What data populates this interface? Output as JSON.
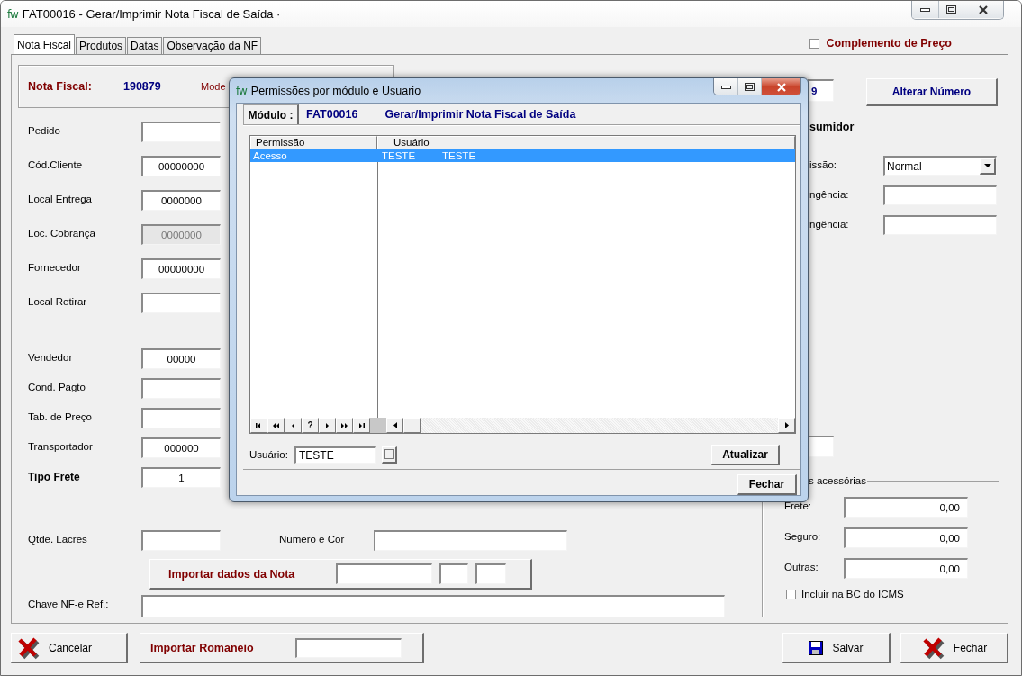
{
  "window": {
    "logo": "fw",
    "title": "FAT00016 - Gerar/Imprimir Nota Fiscal de Saída ·"
  },
  "tabs": [
    {
      "label": "Nota Fiscal",
      "selected": true
    },
    {
      "label": "Produtos",
      "selected": false
    },
    {
      "label": "Datas",
      "selected": false
    },
    {
      "label": "Observação da NF",
      "selected": false
    }
  ],
  "complemento": {
    "label": "Complemento de Preço",
    "checked": false
  },
  "header_panel": {
    "label": "Nota Fiscal:",
    "number": "190879",
    "label_2": "Mode"
  },
  "left_fields": [
    {
      "label": "Pedido",
      "kind": "plain",
      "disabled": false
    },
    {
      "label": "Cód.Cliente",
      "value": "00000000",
      "kind": "plain",
      "disabled": false
    },
    {
      "label": "Local Entrega",
      "value": "0000000",
      "kind": "plain",
      "disabled": false
    },
    {
      "label": "Loc. Cobrança",
      "value": "0000000",
      "kind": "plain",
      "disabled": true
    },
    {
      "label": "Fornecedor",
      "value": "00000000",
      "kind": "plain",
      "disabled": false
    },
    {
      "label": "Local Retirar",
      "kind": "plain",
      "disabled": false
    },
    {
      "label": "Vendedor",
      "value": "00000",
      "kind": "plain",
      "disabled": false
    },
    {
      "label": "Cond. Pagto",
      "kind": "plain",
      "disabled": false
    },
    {
      "label": "Tab. de Preço",
      "kind": "plain",
      "disabled": false
    },
    {
      "label": "Transportador",
      "value": "000000",
      "kind": "plain",
      "disabled": false
    },
    {
      "label": "Tipo Frete",
      "value": "1",
      "kind": "strong",
      "disabled": false
    }
  ],
  "lacres": {
    "label": "Qtde. Lacres",
    "label_2": "Numero e Cor"
  },
  "importar_nota": {
    "label": "Importar dados da Nota"
  },
  "chave": {
    "label": "Chave NF-e Ref.:"
  },
  "right": {
    "numero_value": "9",
    "alterar_button": "Alterar Número",
    "consumidor_label": "sumidor",
    "rows": [
      {
        "label": "issão:",
        "value": "Normal",
        "kind": "select"
      },
      {
        "label": "ngência:",
        "kind": "text"
      },
      {
        "label": "ngência:",
        "kind": "text"
      }
    ]
  },
  "acessorias": {
    "title": "s acessórias",
    "rows": [
      {
        "label": "Frete:",
        "value": "0,00"
      },
      {
        "label": "Seguro:",
        "value": "0,00"
      },
      {
        "label": "Outras:",
        "value": "0,00"
      }
    ],
    "incluir": {
      "label": "Incluir na BC do ICMS",
      "checked": false
    }
  },
  "bottom": {
    "buttons": [
      {
        "label": "Cancelar",
        "kind": "cancel"
      },
      {
        "label": "Salvar",
        "kind": "save"
      },
      {
        "label": "Fechar",
        "kind": "close"
      }
    ],
    "romaneio": "Importar Romaneio"
  },
  "dialog": {
    "logo": "fw",
    "title": "Permissões por módulo e Usuario",
    "module_tab": {
      "label": "Módulo :",
      "selected": true
    },
    "module_code": "FAT00016",
    "module_name": "Gerar/Imprimir Nota Fiscal de Saída",
    "table": {
      "columns": [
        "Permissão",
        "Usuário"
      ],
      "rows": [
        {
          "cells": [
            "Acesso",
            "TESTE",
            "TESTE"
          ],
          "selected": true
        }
      ]
    },
    "navigator": [
      {
        "kind": "first"
      },
      {
        "kind": "prior-page"
      },
      {
        "kind": "prior"
      },
      {
        "kind": "help",
        "label": "?"
      },
      {
        "kind": "next"
      },
      {
        "kind": "next-page"
      },
      {
        "kind": "last"
      }
    ],
    "user_field": {
      "label": "Usuário:",
      "value": "TESTE"
    },
    "update_button": "Atualizar",
    "close_button": "Fechar"
  }
}
